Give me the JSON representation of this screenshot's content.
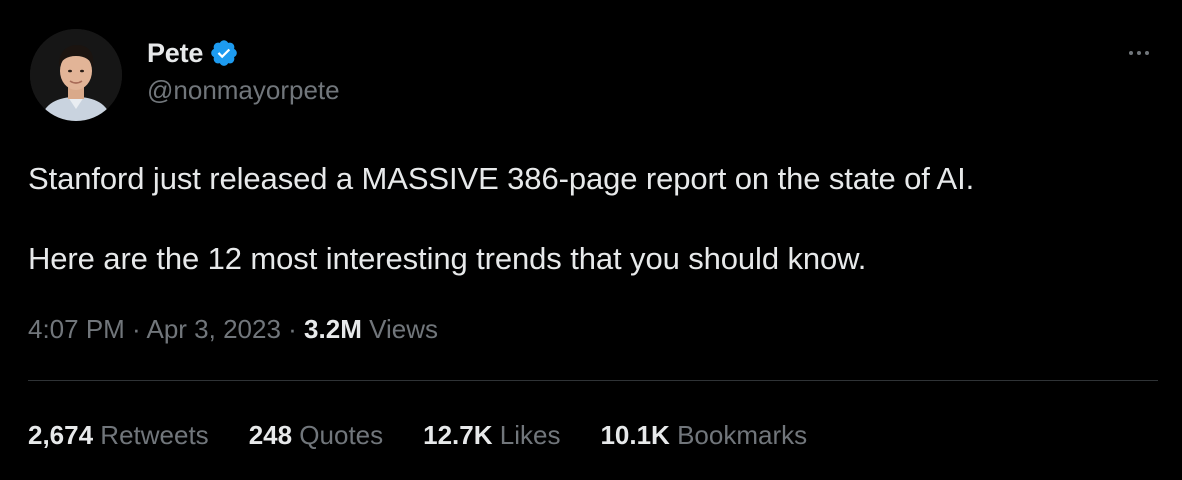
{
  "author": {
    "name": "Pete",
    "handle": "@nonmayorpete",
    "verified_icon": "verified-badge-icon",
    "verified_color": "#1d9bf0"
  },
  "tweet": {
    "paragraphs": [
      "Stanford just released a MASSIVE 386-page report on the state of AI.",
      "Here are the 12 most interesting trends that you should know."
    ]
  },
  "meta": {
    "time": "4:07 PM",
    "separator1": " · ",
    "date": "Apr 3, 2023",
    "separator2": " · ",
    "views_count": "3.2M",
    "views_label": " Views"
  },
  "stats": {
    "retweets": {
      "count": "2,674",
      "label": " Retweets"
    },
    "quotes": {
      "count": "248",
      "label": " Quotes"
    },
    "likes": {
      "count": "12.7K",
      "label": " Likes"
    },
    "bookmarks": {
      "count": "10.1K",
      "label": " Bookmarks"
    }
  },
  "colors": {
    "background": "#000000",
    "primary_text": "#e7e9ea",
    "secondary_text": "#71767b",
    "divider": "#2f3336"
  },
  "icons": {
    "more": "more-horizontal-icon"
  }
}
